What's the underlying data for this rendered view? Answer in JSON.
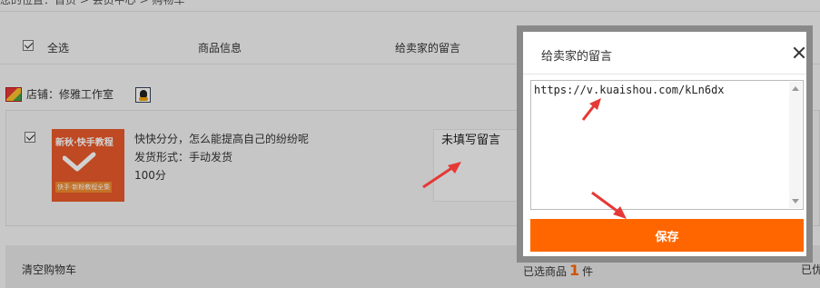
{
  "breadcrumb": "您的位置：首页 > 会员中心 > 购物车",
  "header": {
    "select_all": "全选",
    "product_info": "商品信息",
    "seller_message": "给卖家的留言"
  },
  "shop": {
    "name": "店铺：修雅工作室"
  },
  "item": {
    "thumb_title": "新秋·快手教程",
    "thumb_badge": "快手·新粉教程全集",
    "title": "快快分分，怎么能提高自己的纷纷呢",
    "shipping": "发货形式：手动发货",
    "points": "100分",
    "message_status": "未填写留言"
  },
  "footer": {
    "clear_cart": "清空购物车",
    "selected_prefix": "已选商品",
    "selected_count": "1",
    "selected_suffix": "件",
    "truncated": "已优"
  },
  "dialog": {
    "title": "给卖家的留言",
    "message_value": "https://v.kuaishou.com/kLn6dx",
    "save_label": "保存"
  },
  "colors": {
    "accent": "#ff6600",
    "annotation_arrow": "#e53935"
  },
  "icons": [
    "shop-icon",
    "qq-icon",
    "close-icon",
    "checkbox-icon",
    "scroll-up-icon",
    "scroll-down-icon"
  ]
}
